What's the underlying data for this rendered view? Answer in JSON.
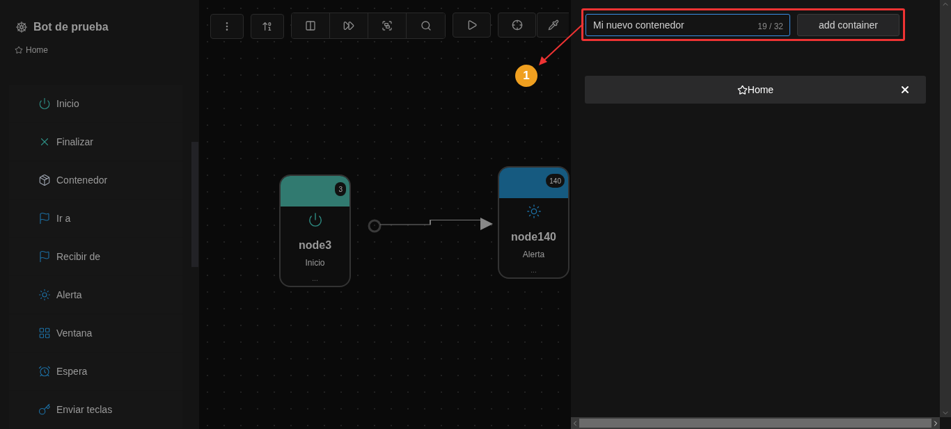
{
  "project": {
    "title": "Bot de prueba",
    "breadcrumb": "Home"
  },
  "palette": [
    {
      "label": "Inicio",
      "kind": "start"
    },
    {
      "label": "Finalizar",
      "kind": "end"
    },
    {
      "label": "Contenedor",
      "kind": "container"
    },
    {
      "label": "Ir a",
      "kind": "goto"
    },
    {
      "label": "Recibir de",
      "kind": "receive"
    },
    {
      "label": "Alerta",
      "kind": "alert"
    },
    {
      "label": "Ventana",
      "kind": "window"
    },
    {
      "label": "Espera",
      "kind": "wait"
    },
    {
      "label": "Enviar teclas",
      "kind": "keys"
    }
  ],
  "nodes": [
    {
      "badge": "3",
      "title": "node3",
      "subtitle": "Inicio",
      "more": "...",
      "kind": "start",
      "color": "#317a70"
    },
    {
      "badge": "140",
      "title": "node140",
      "subtitle": "Alerta",
      "more": "...",
      "kind": "alert",
      "color": "#165a80"
    }
  ],
  "container_form": {
    "value": "Mi nuevo contenedor",
    "counter": "19 / 32",
    "button": "add container"
  },
  "containers": [
    {
      "label": "Home"
    }
  ],
  "annotation": {
    "label": "1"
  }
}
